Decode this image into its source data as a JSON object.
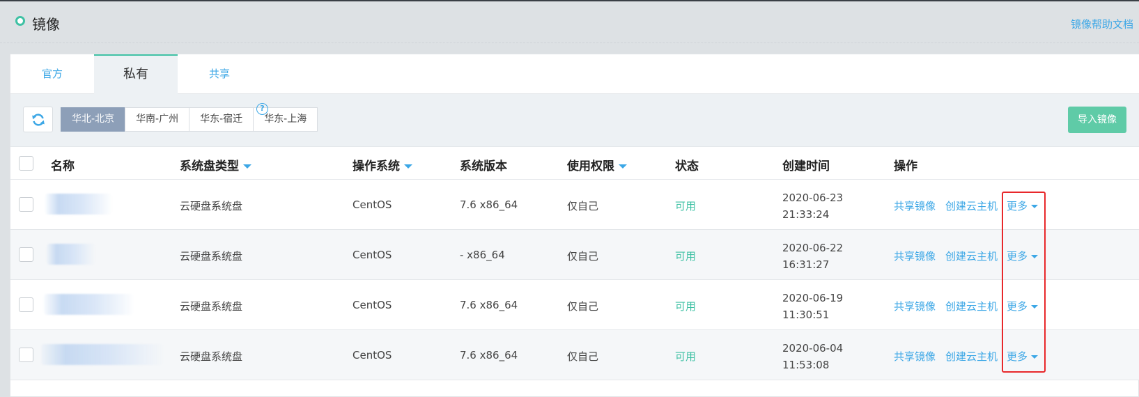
{
  "header": {
    "title": "镜像",
    "help_link": "镜像帮助文档"
  },
  "tabs": [
    {
      "label": "官方"
    },
    {
      "label": "私有"
    },
    {
      "label": "共享"
    }
  ],
  "regions": [
    {
      "label": "华北-北京"
    },
    {
      "label": "华南-广州"
    },
    {
      "label": "华东-宿迁"
    },
    {
      "label": "华东-上海"
    }
  ],
  "import_button": "导入镜像",
  "columns": {
    "name": "名称",
    "disk_type": "系统盘类型",
    "os": "操作系统",
    "version": "系统版本",
    "permission": "使用权限",
    "status": "状态",
    "created": "创建时间",
    "actions": "操作"
  },
  "help_icon": "question-mark-icon",
  "rows": [
    {
      "disk_type": "云硬盘系统盘",
      "os": "CentOS",
      "version": "7.6 x86_64",
      "permission": "仅自己",
      "status": "可用",
      "date": "2020-06-23",
      "time": "21:33:24",
      "share": "共享镜像",
      "create": "创建云主机",
      "more": "更多"
    },
    {
      "disk_type": "云硬盘系统盘",
      "os": "CentOS",
      "version": "- x86_64",
      "permission": "仅自己",
      "status": "可用",
      "date": "2020-06-22",
      "time": "16:31:27",
      "share": "共享镜像",
      "create": "创建云主机",
      "more": "更多"
    },
    {
      "disk_type": "云硬盘系统盘",
      "os": "CentOS",
      "version": "7.6 x86_64",
      "permission": "仅自己",
      "status": "可用",
      "date": "2020-06-19",
      "time": "11:30:51",
      "share": "共享镜像",
      "create": "创建云主机",
      "more": "更多"
    },
    {
      "disk_type": "云硬盘系统盘",
      "os": "CentOS",
      "version": "7.6 x86_64",
      "permission": "仅自己",
      "status": "可用",
      "date": "2020-06-04",
      "time": "11:53:08",
      "share": "共享镜像",
      "create": "创建云主机",
      "more": "更多"
    }
  ],
  "colors": {
    "accent": "#3ca7e6",
    "status_ok": "#3fc1a4",
    "import_button": "#5fcba7",
    "active_region": "#8d9fb8",
    "highlight_box": "#e8282b"
  }
}
